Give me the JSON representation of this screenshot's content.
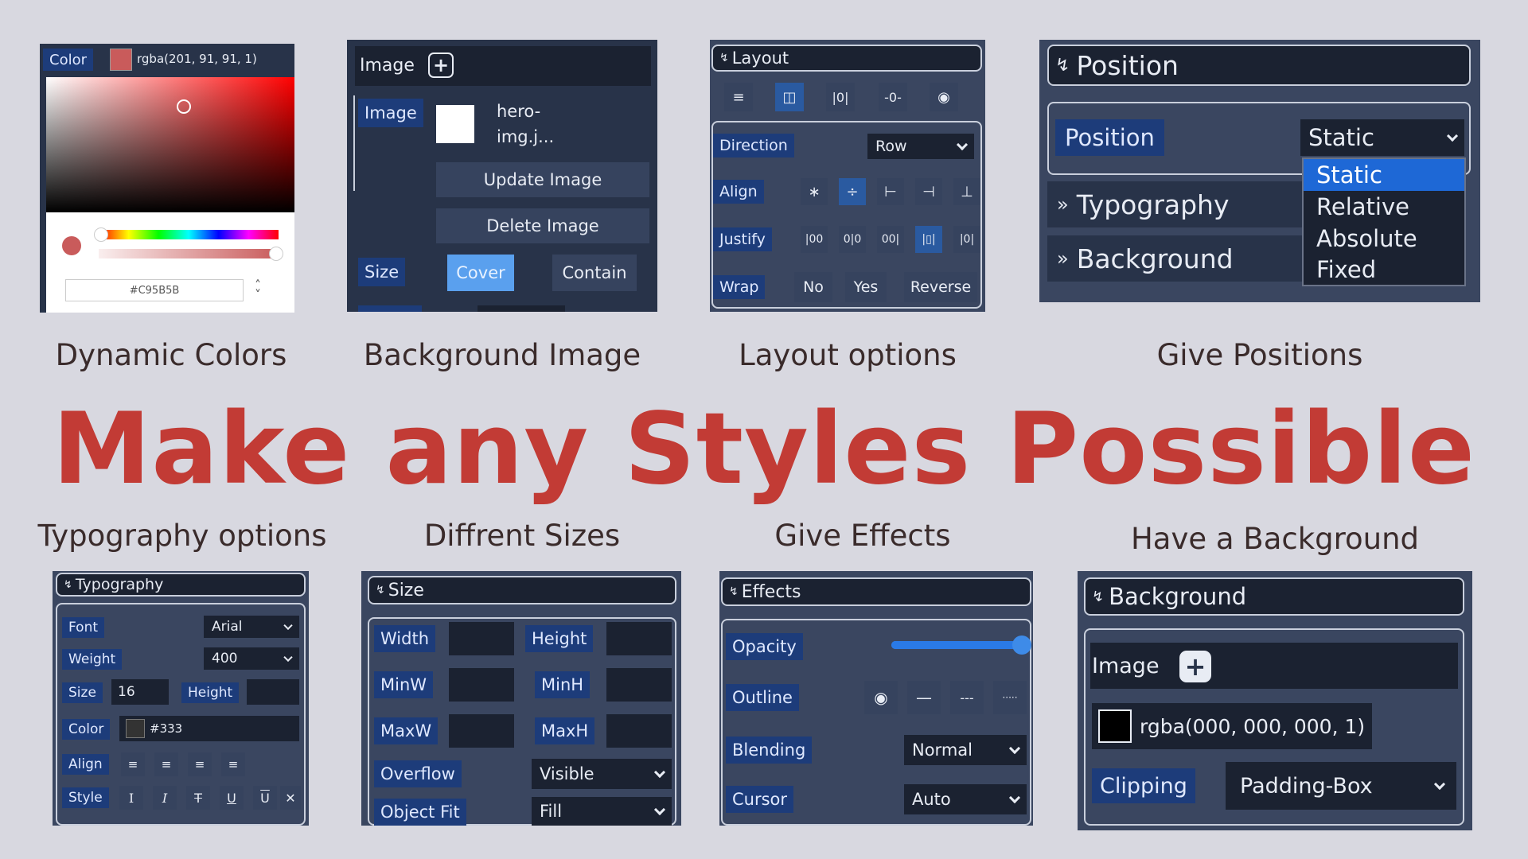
{
  "headline": "Make any Styles Possible",
  "captions": {
    "dynamic_colors": "Dynamic Colors",
    "background_image": "Background Image",
    "layout_options": "Layout options",
    "give_positions": "Give Positions",
    "typography_options": "Typography options",
    "different_sizes": "Diffrent Sizes",
    "give_effects": "Give Effects",
    "have_background": "Have a Background"
  },
  "colors": {
    "accent": "#c23b35",
    "panel": "#283349",
    "label": "#1d3c7a",
    "picked": "#C95B5B"
  },
  "color_panel": {
    "label": "Color",
    "value": "rgba(201, 91, 91, 1)",
    "hex": "#C95B5B"
  },
  "bg_image_panel": {
    "header": "Image",
    "image_label": "Image",
    "file_name_line1": "hero-",
    "file_name_line2": "img.j...",
    "update_btn": "Update Image",
    "delete_btn": "Delete Image",
    "size_label": "Size",
    "cover_btn": "Cover",
    "contain_btn": "Contain"
  },
  "layout_panel": {
    "header": "Layout",
    "direction_label": "Direction",
    "direction_value": "Row",
    "align_label": "Align",
    "justify_label": "Justify",
    "wrap_label": "Wrap",
    "wrap_no": "No",
    "wrap_yes": "Yes",
    "wrap_reverse": "Reverse"
  },
  "position_panel": {
    "header": "Position",
    "position_label": "Position",
    "position_value": "Static",
    "typography": "Typography",
    "background": "Background",
    "options": [
      "Static",
      "Relative",
      "Absolute",
      "Fixed"
    ]
  },
  "typography_panel": {
    "header": "Typography",
    "font_label": "Font",
    "font_value": "Arial",
    "weight_label": "Weight",
    "weight_value": "400",
    "size_label": "Size",
    "size_value": "16",
    "height_label": "Height",
    "color_label": "Color",
    "color_value": "#333",
    "align_label": "Align",
    "style_label": "Style"
  },
  "size_panel": {
    "header": "Size",
    "width": "Width",
    "height": "Height",
    "minw": "MinW",
    "minh": "MinH",
    "maxw": "MaxW",
    "maxh": "MaxH",
    "overflow_label": "Overflow",
    "overflow_value": "Visible",
    "objectfit_label": "Object Fit",
    "objectfit_value": "Fill"
  },
  "effects_panel": {
    "header": "Effects",
    "opacity_label": "Opacity",
    "opacity_value": 1.0,
    "outline_label": "Outline",
    "blending_label": "Blending",
    "blending_value": "Normal",
    "cursor_label": "Cursor",
    "cursor_value": "Auto"
  },
  "background_panel": {
    "header": "Background",
    "image_label": "Image",
    "color_value": "rgba(000, 000, 000, 1)",
    "clipping_label": "Clipping",
    "clipping_value": "Padding-Box"
  }
}
